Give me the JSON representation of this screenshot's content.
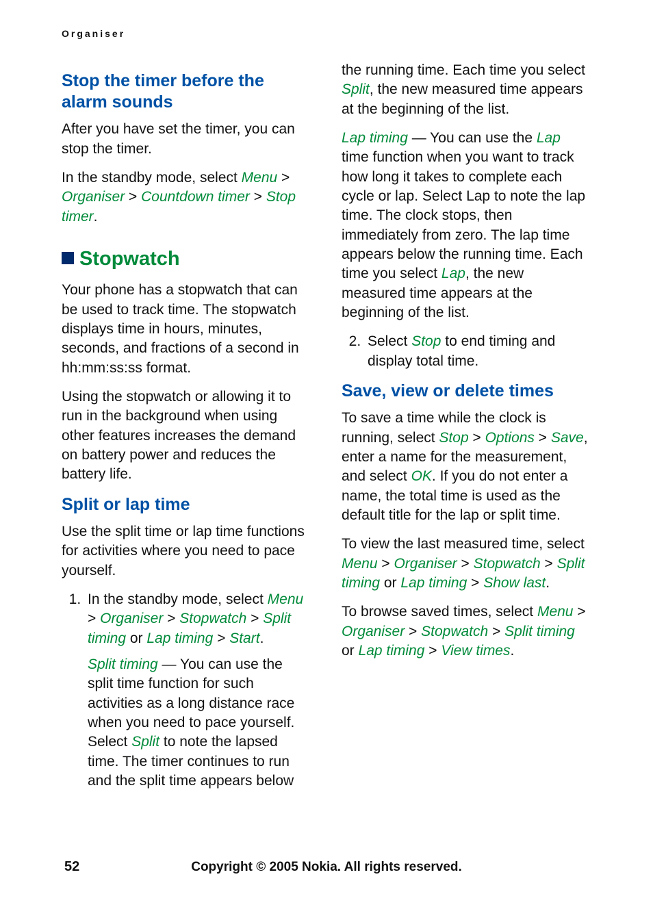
{
  "running_head": "Organiser",
  "page_number": "52",
  "footer": "Copyright © 2005 Nokia. All rights reserved.",
  "left": {
    "h_stop_timer": "Stop the timer before the alarm sounds",
    "p_after_set": "After you have set the timer, you can stop the timer.",
    "p_standby_prefix": "In the standby mode, select ",
    "nav_menu": "Menu",
    "nav_organiser": "Organiser",
    "nav_countdown": "Countdown timer",
    "nav_stop_timer": "Stop timer",
    "h_stopwatch": "Stopwatch",
    "p_stopwatch_intro": "Your phone has a stopwatch that can be used to track time. The stopwatch displays time in hours, minutes, seconds, and fractions of a second in hh:mm:ss:ss format.",
    "p_stopwatch_battery": "Using the stopwatch or allowing it to run in the background when using other features increases the demand on battery power and reduces the battery life.",
    "h_split_lap": "Split or lap time",
    "p_split_lap_intro": "Use the split time or lap time functions for activities where you need to pace yourself.",
    "li1_prefix": "In the standby mode, select ",
    "nav_stopwatch": "Stopwatch",
    "nav_split_timing": "Split timing",
    "nav_lap_timing": "Lap timing",
    "nav_start": "Start",
    "split_label": "Split timing",
    "split_body_a": " — You can use the split time function for such activities as a long distance race when you need to pace yourself. Select ",
    "nav_split": "Split",
    "split_body_b": " to note the lapsed time. The timer continues to run and the split time appears below"
  },
  "right": {
    "p_running_cont_a": "the running time. Each time you select ",
    "nav_split": "Split",
    "p_running_cont_b": ", the new measured time appears at the beginning of the list.",
    "lap_label": "Lap timing",
    "lap_body_a": " — You can use the ",
    "nav_lap": "Lap",
    "lap_body_b": " time function when you want to track how long it takes to complete each cycle or lap. Select Lap to note the lap time. The clock stops, then immediately from zero. The lap time appears below the running time. Each time you select ",
    "lap_body_c": ", the new measured time appears at the beginning of the list.",
    "li2_prefix": "Select ",
    "nav_stop": "Stop",
    "li2_suffix": " to end timing and display total time.",
    "h_save_view": "Save, view or delete times",
    "save_a": "To save a time while the clock is running, select ",
    "nav_options": "Options",
    "nav_save": "Save",
    "save_b": ", enter a name for the measurement, and select ",
    "nav_ok": "OK",
    "save_c": ". If you do not enter a name, the total time is used as the default title for the lap or split time.",
    "view_a": "To view the last measured time, select ",
    "nav_menu": "Menu",
    "nav_organiser": "Organiser",
    "nav_stopwatch": "Stopwatch",
    "nav_split_timing": "Split timing",
    "nav_lap_timing": "Lap timing",
    "nav_show_last": "Show last",
    "browse_a": "To browse saved times, select ",
    "nav_view_times": "View times"
  }
}
